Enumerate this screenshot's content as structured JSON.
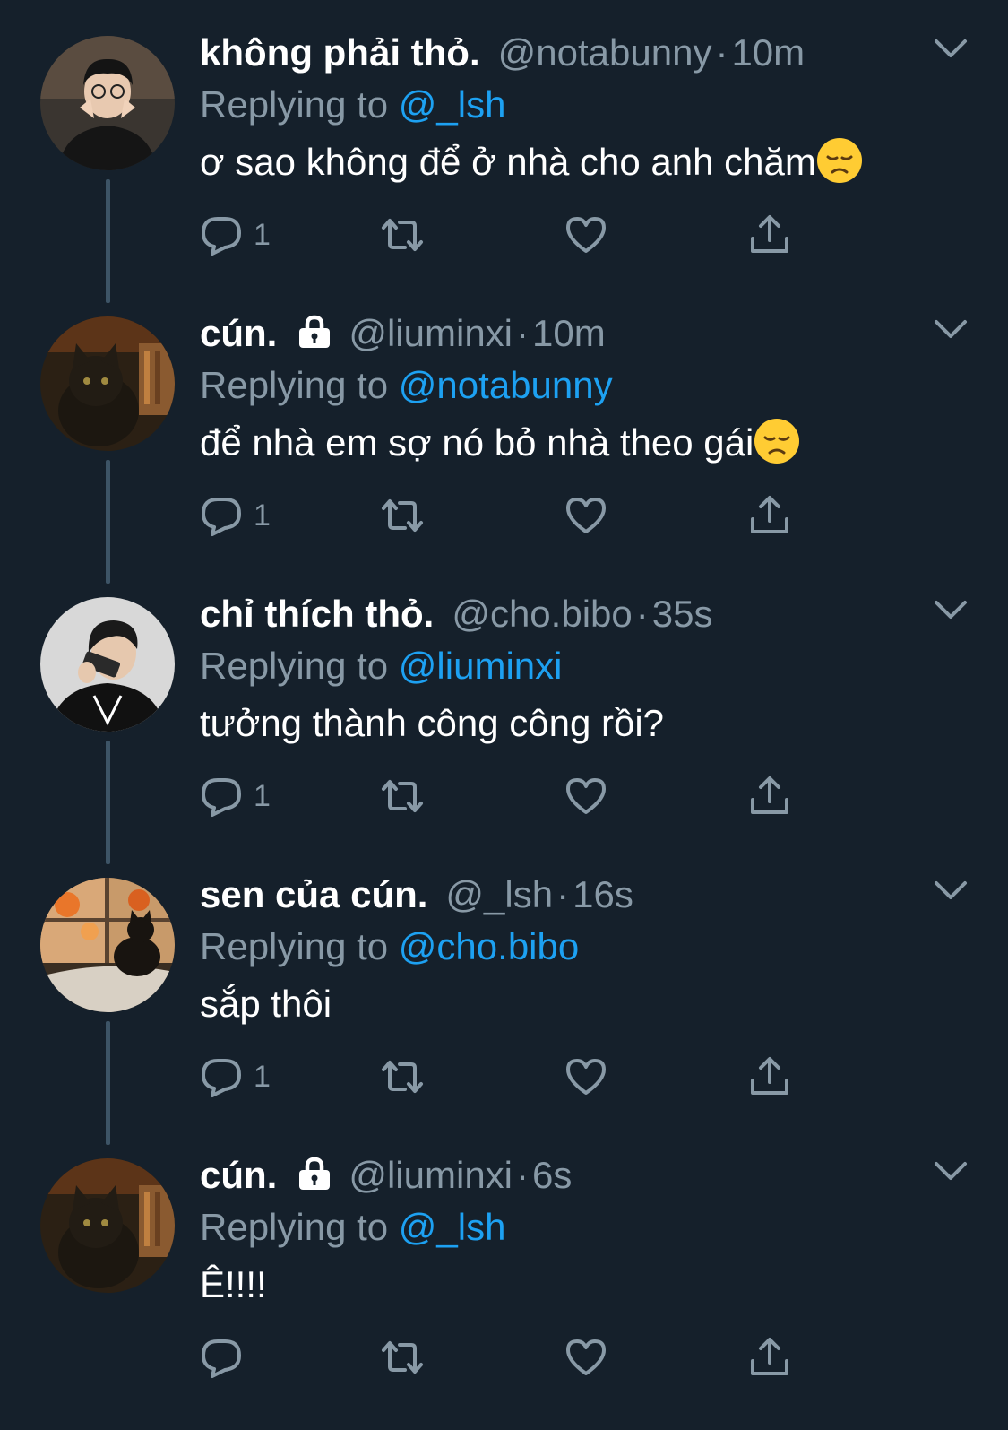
{
  "colors": {
    "background": "#15202b",
    "secondary_text": "#8899a6",
    "mention": "#1da1f2",
    "thread_line": "#3d5466"
  },
  "tweets": [
    {
      "name": "không phải thỏ.",
      "locked": false,
      "handle": "@notabunny",
      "dot": "·",
      "time": "10m",
      "replying_prefix": "Replying to",
      "replying_to": "@_lsh",
      "text": "ơ sao không để ở nhà cho anh chăm",
      "emoji": "disappointed-face",
      "reply_count": "1",
      "avatar": "person-avatar"
    },
    {
      "name": "cún.",
      "locked": true,
      "handle": "@liuminxi",
      "dot": "·",
      "time": "10m",
      "replying_prefix": "Replying to",
      "replying_to": "@notabunny",
      "text": "để nhà em sợ nó bỏ nhà theo gái",
      "emoji": "disappointed-face",
      "reply_count": "1",
      "avatar": "cat-avatar"
    },
    {
      "name": "chỉ thích thỏ.",
      "locked": false,
      "handle": "@cho.bibo",
      "dot": "·",
      "time": "35s",
      "replying_prefix": "Replying to",
      "replying_to": "@liuminxi",
      "text": "tưởng thành công công rồi?",
      "emoji": "",
      "reply_count": "1",
      "avatar": "person-avatar"
    },
    {
      "name": "sen của cún.",
      "locked": false,
      "handle": "@_lsh",
      "dot": "·",
      "time": "16s",
      "replying_prefix": "Replying to",
      "replying_to": "@cho.bibo",
      "text": "sắp thôi",
      "emoji": "",
      "reply_count": "1",
      "avatar": "cat-window-avatar"
    },
    {
      "name": "cún.",
      "locked": true,
      "handle": "@liuminxi",
      "dot": "·",
      "time": "6s",
      "replying_prefix": "Replying to",
      "replying_to": "@_lsh",
      "text": "Ê!!!!",
      "emoji": "",
      "reply_count": "",
      "avatar": "cat-avatar"
    }
  ]
}
